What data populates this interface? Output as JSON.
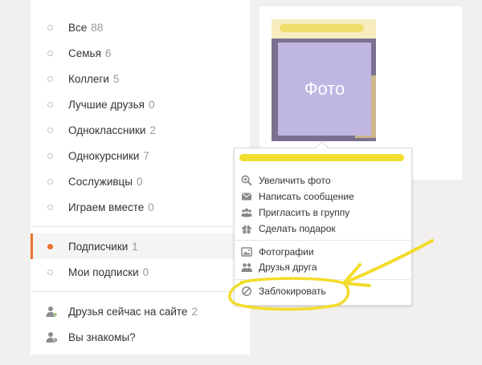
{
  "nav": {
    "items": [
      {
        "label": "Все",
        "count": "88"
      },
      {
        "label": "Семья",
        "count": "6"
      },
      {
        "label": "Коллеги",
        "count": "5"
      },
      {
        "label": "Лучшие друзья",
        "count": "0"
      },
      {
        "label": "Одноклассники",
        "count": "2"
      },
      {
        "label": "Однокурсники",
        "count": "7"
      },
      {
        "label": "Сослуживцы",
        "count": "0"
      },
      {
        "label": "Играем вместе",
        "count": "0"
      }
    ],
    "subscribers": {
      "label": "Подписчики",
      "count": "1"
    },
    "my_subscriptions": {
      "label": "Мои подписки",
      "count": "0"
    },
    "online": {
      "label": "Друзья сейчас на сайте",
      "count": "2"
    },
    "maybe_know": {
      "label": "Вы знакомы?"
    }
  },
  "card": {
    "photo_label": "Фото"
  },
  "menu": {
    "group1": [
      {
        "label": "Увеличить фото",
        "icon": "zoom-in-icon"
      },
      {
        "label": "Написать сообщение",
        "icon": "envelope-icon"
      },
      {
        "label": "Пригласить в группу",
        "icon": "group-icon"
      },
      {
        "label": "Сделать подарок",
        "icon": "gift-icon"
      }
    ],
    "group2": [
      {
        "label": "Фотографии",
        "icon": "photos-icon"
      },
      {
        "label": "Друзья друга",
        "icon": "friends-icon"
      }
    ],
    "block": {
      "label": "Заблокировать",
      "icon": "block-icon"
    }
  },
  "colors": {
    "accent": "#eb722e",
    "annotation": "#f3dc2b",
    "photo_placeholder": "#c0b6e2"
  }
}
